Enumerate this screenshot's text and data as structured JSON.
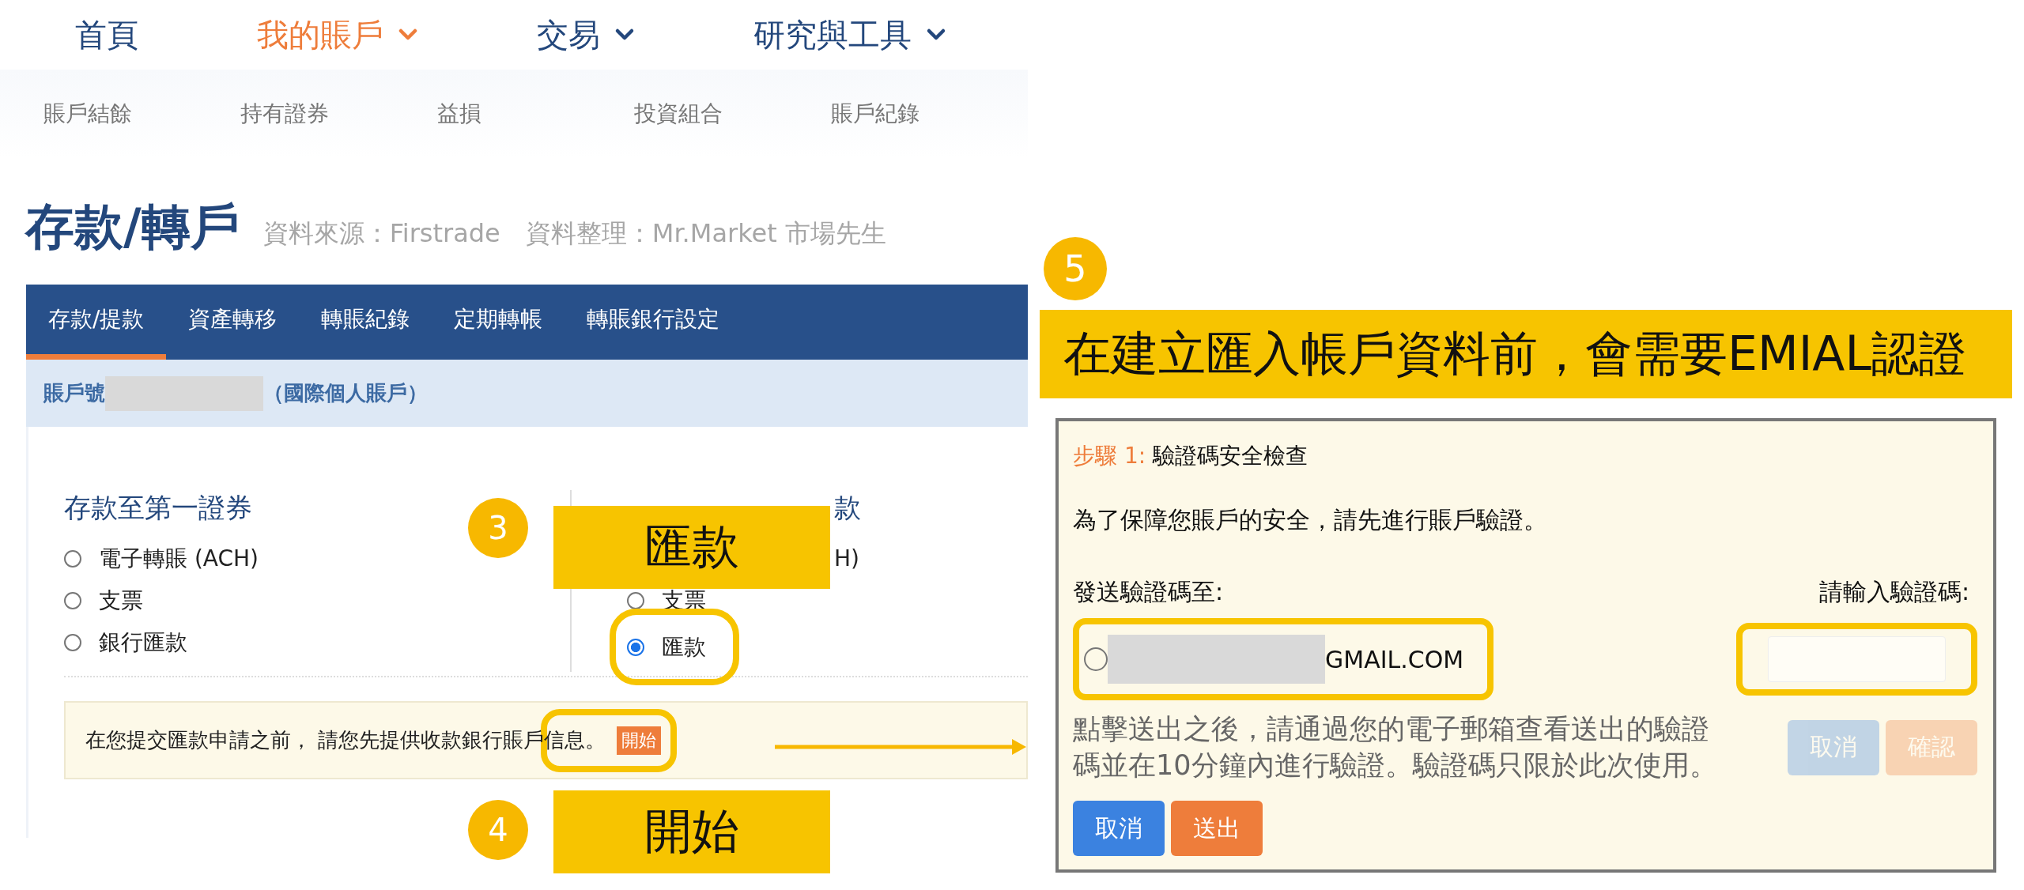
{
  "nav": [
    {
      "label": "首頁",
      "selected": false,
      "dropdown": false
    },
    {
      "label": "我的賬戶",
      "selected": true,
      "dropdown": true
    },
    {
      "label": "交易",
      "selected": false,
      "dropdown": true
    },
    {
      "label": "研究與工具",
      "selected": false,
      "dropdown": true
    }
  ],
  "subnav": [
    "賬戶結餘",
    "持有證券",
    "益損",
    "投資組合",
    "賬戶紀錄"
  ],
  "page": {
    "title": "存款/轉戶",
    "subtitle": "資料來源：Firstrade　資料整理：Mr.Market 市場先生"
  },
  "tabs": [
    {
      "label": "存款/提款",
      "selected": true
    },
    {
      "label": "資產轉移",
      "selected": false
    },
    {
      "label": "轉賬紀錄",
      "selected": false
    },
    {
      "label": "定期轉帳",
      "selected": false
    },
    {
      "label": "轉賬銀行設定",
      "selected": false
    }
  ],
  "account": {
    "label": "賬戶號",
    "type": "（國際個人賬戶）"
  },
  "deposit": {
    "title": "存款至第一證券",
    "options": [
      {
        "label": "電子轉賬 (ACH)",
        "selected": false
      },
      {
        "label": "支票",
        "selected": false
      },
      {
        "label": "銀行匯款",
        "selected": false
      }
    ]
  },
  "withdraw": {
    "title_visible": "款",
    "covered_option_visible": "H)",
    "options": [
      {
        "label": "支票",
        "selected": false
      },
      {
        "label": "匯款",
        "selected": true
      }
    ]
  },
  "notice": {
    "text": "在您提交匯款申請之前， 請您先提供收款銀行賬戶信息。",
    "button": "開始"
  },
  "annotations": [
    {
      "step": "3",
      "label": "匯款"
    },
    {
      "step": "4",
      "label": "開始"
    },
    {
      "step": "5",
      "label": "在建立匯入帳戶資料前，會需要EMIAL認證"
    }
  ],
  "dialog": {
    "step_label": "步驟 1:",
    "step_title": "驗證碼安全檢查",
    "intro": "為了保障您賬戶的安全，請先進行賬戶驗證。",
    "send_to_label": "發送驗證碼至:",
    "email_visible": "GMAIL.COM",
    "email_selected": false,
    "code_label": "請輸入驗證碼:",
    "hint": "點擊送出之後，請通過您的電子郵箱查看送出的驗證碼並在10分鐘內進行驗證。驗證碼只限於此次使用。",
    "code_buttons": [
      {
        "label": "取消",
        "kind": "cancel",
        "disabled": true
      },
      {
        "label": "確認",
        "kind": "confirm",
        "disabled": true
      }
    ],
    "buttons": [
      {
        "label": "取消",
        "kind": "cancel",
        "disabled": false
      },
      {
        "label": "送出",
        "kind": "submit",
        "disabled": false
      }
    ]
  }
}
